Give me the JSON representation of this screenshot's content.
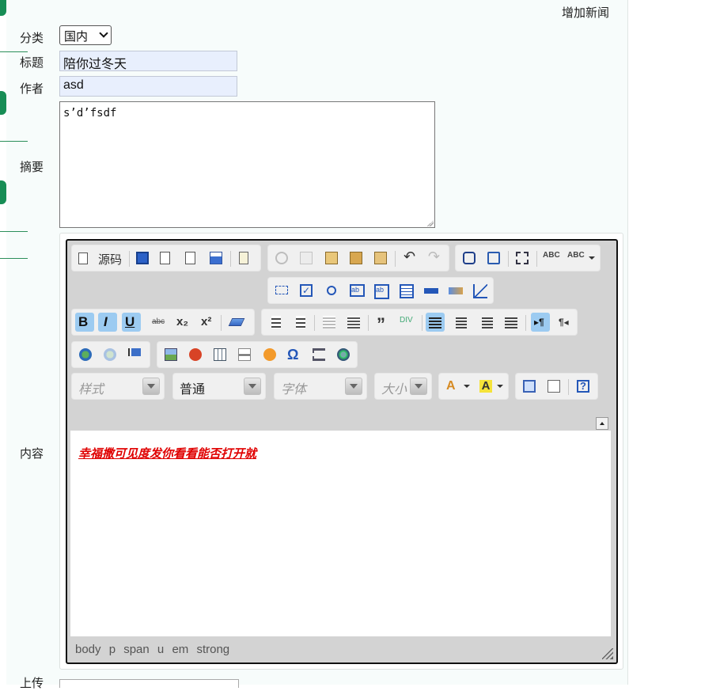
{
  "header": {
    "add_news": "增加新闻"
  },
  "form": {
    "category_label": "分类",
    "category_value": "国内",
    "title_label": "标题",
    "title_value": "陪你过冬天",
    "author_label": "作者",
    "author_value": "asd",
    "summary_label": "摘要",
    "summary_value": "s’d’fsdf",
    "content_label": "内容",
    "upload_label": "上传"
  },
  "editor": {
    "source_label": "源码",
    "style_combo": "样式",
    "format_combo": "普通",
    "font_combo": "字体",
    "size_combo": "大小",
    "content_text": "幸福撒可见度发你看看能否打开就",
    "content_color": "#e00000",
    "path": [
      "body",
      "p",
      "span",
      "u",
      "em",
      "strong"
    ],
    "active_buttons": [
      "bold",
      "italic",
      "underline",
      "justify-left",
      "bidi-ltr"
    ],
    "accent": "#9ccbf1"
  }
}
